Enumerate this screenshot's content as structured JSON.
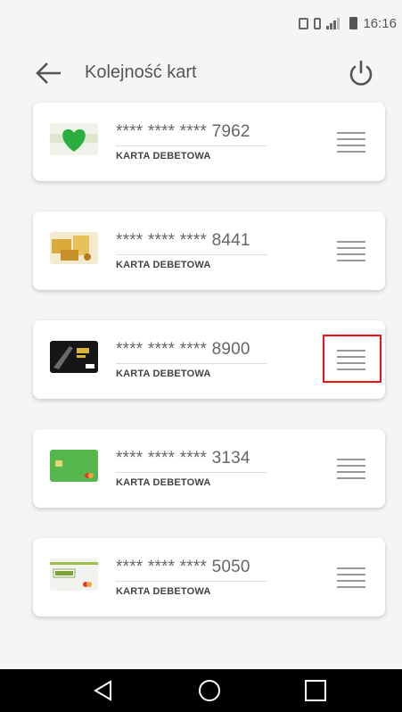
{
  "status_bar": {
    "time": "16:16",
    "icons": [
      "nfc-icon",
      "vibrate-icon",
      "signal-icon",
      "battery-icon"
    ]
  },
  "app_bar": {
    "title": "Kolejność kart",
    "back_icon": "arrow-left-icon",
    "power_icon": "power-icon"
  },
  "cards": [
    {
      "number": "**** **** **** 7962",
      "type": "KARTA DEBETOWA",
      "thumb": "green-heart-card"
    },
    {
      "number": "**** **** **** 8441",
      "type": "KARTA DEBETOWA",
      "thumb": "gold-card"
    },
    {
      "number": "**** **** **** 8900",
      "type": "KARTA DEBETOWA",
      "thumb": "black-card"
    },
    {
      "number": "**** **** **** 3134",
      "type": "KARTA DEBETOWA",
      "thumb": "green-card"
    },
    {
      "number": "**** **** **** 5050",
      "type": "KARTA DEBETOWA",
      "thumb": "agro-card"
    }
  ],
  "colors": {
    "background": "#f5f5f5",
    "highlight": "#e11111",
    "navbar": "#000000"
  },
  "nav_bar": {
    "icons": [
      "nav-back-icon",
      "nav-home-icon",
      "nav-recents-icon"
    ]
  }
}
